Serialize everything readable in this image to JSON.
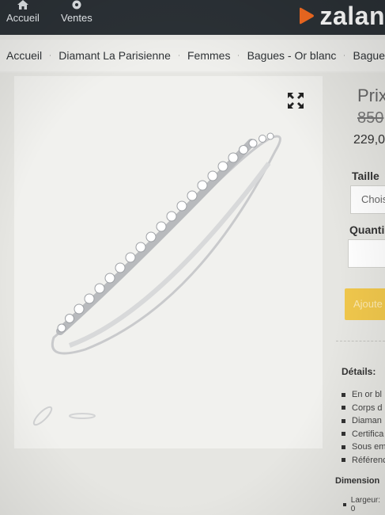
{
  "nav": {
    "items": [
      {
        "label": "Accueil",
        "icon": "home-icon"
      },
      {
        "label": "Ventes",
        "icon": "ventes-icon"
      }
    ]
  },
  "brand": {
    "logo_text": "zalan",
    "accent": "#f36b21"
  },
  "breadcrumb": [
    "Accueil",
    "Diamant La Parisienne",
    "Femmes",
    "Bagues - Or blanc",
    "Bague"
  ],
  "product": {
    "price_label": "Prix",
    "old_price": "850",
    "new_price": "229,0",
    "size_label": "Taille",
    "size_select": "Chois",
    "quantity_label": "Quanti",
    "quantity_value": "",
    "add_button": "Ajoute",
    "button_color": "#f0c74c"
  },
  "details": {
    "title": "Détails:",
    "items": [
      "En or bl",
      "Corps d",
      "Diaman",
      "Certifica",
      "Sous em",
      "Référenc"
    ],
    "dimension_title": "Dimension",
    "largeur": "Largeur: 0"
  }
}
